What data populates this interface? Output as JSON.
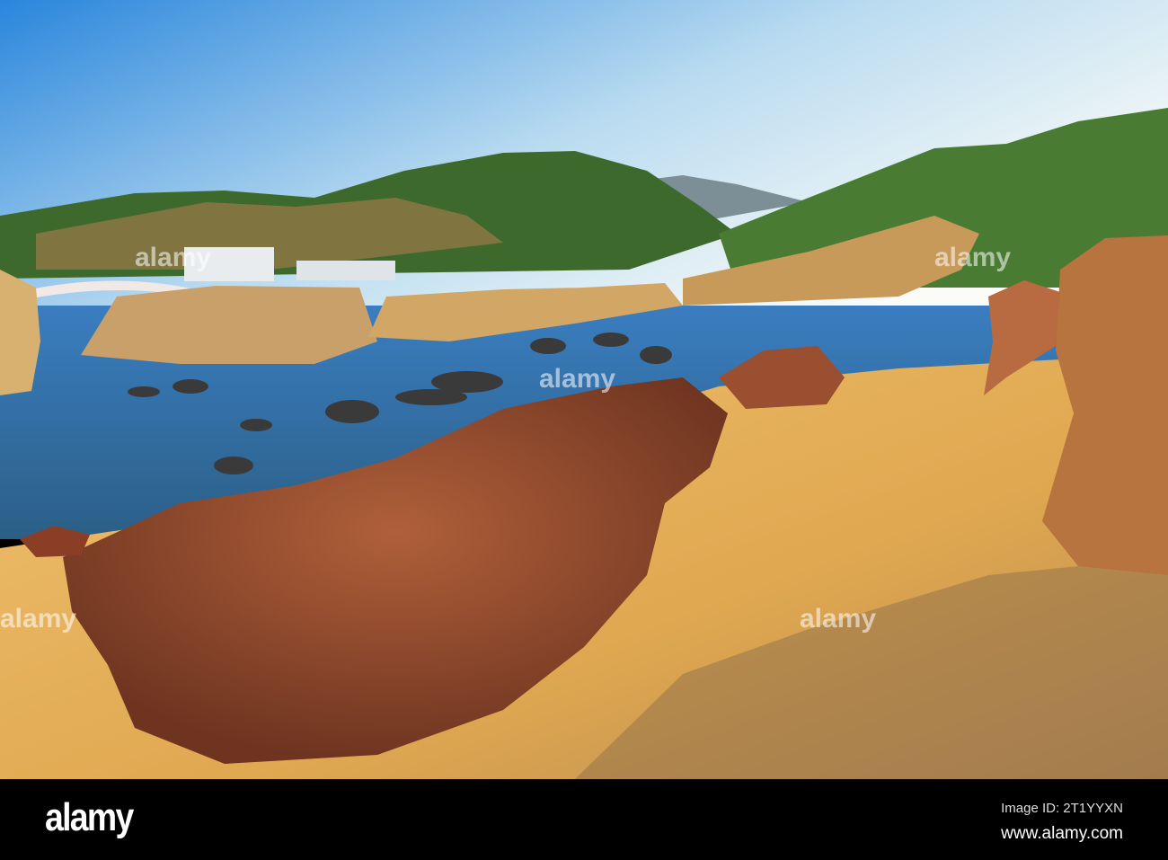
{
  "photo": {
    "subject": "coastal-rock-formations",
    "colors": {
      "sky_top": "#2f8fe0",
      "sky_bottom": "#e8f3f6",
      "sea": "#3f7fb8",
      "rock": "#a0522d",
      "sand": "#e6b25a",
      "hills": "#3f6e2e"
    }
  },
  "watermark": {
    "text": "alamy"
  },
  "footer": {
    "logo": "alamy",
    "image_id": "Image ID: 2T1YYXN",
    "website": "www.alamy.com"
  }
}
